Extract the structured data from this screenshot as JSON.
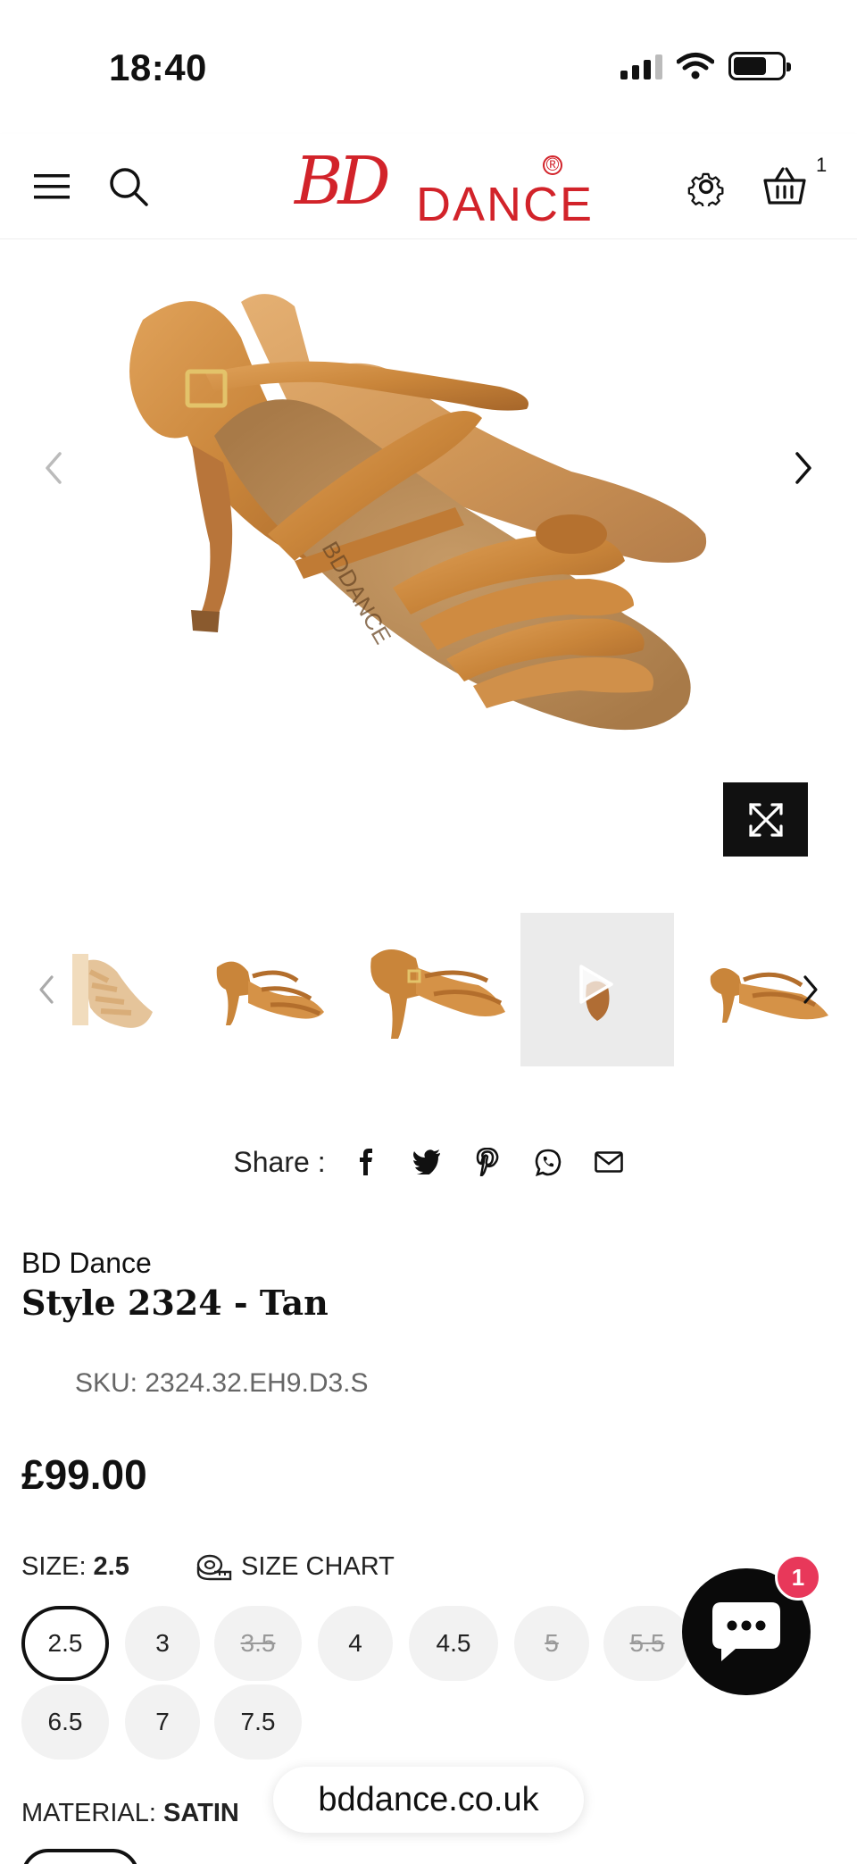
{
  "status_bar": {
    "time": "18:40"
  },
  "header": {
    "logo_script": "BD",
    "logo_text": "DANCE",
    "logo_reg": "®",
    "cart_count": "1"
  },
  "gallery": {
    "thumbnails": [
      "thumb-1",
      "thumb-2",
      "thumb-3",
      "thumb-video",
      "thumb-5"
    ]
  },
  "share": {
    "label": "Share :"
  },
  "product": {
    "brand": "BD Dance",
    "title": "Style 2324 - Tan",
    "sku": "SKU: 2324.32.EH9.D3.S",
    "price": "£99.00",
    "size_label": "SIZE:",
    "size_value": "2.5",
    "size_chart_label": "SIZE CHART",
    "sizes": [
      {
        "label": "2.5",
        "state": "selected"
      },
      {
        "label": "3",
        "state": "available"
      },
      {
        "label": "3.5",
        "state": "unavailable"
      },
      {
        "label": "4",
        "state": "available"
      },
      {
        "label": "4.5",
        "state": "available"
      },
      {
        "label": "5",
        "state": "unavailable"
      },
      {
        "label": "5.5",
        "state": "unavailable"
      },
      {
        "label": "6.5",
        "state": "available"
      },
      {
        "label": "7",
        "state": "available"
      },
      {
        "label": "7.5",
        "state": "available"
      }
    ],
    "material_label": "MATERIAL:",
    "material_value": "SATIN"
  },
  "browser": {
    "url": "bddance.co.uk"
  },
  "chat": {
    "badge": "1"
  },
  "colors": {
    "brand_red": "#d2232a",
    "badge_pink": "#e8385a",
    "satin_tan": "#c9853a"
  }
}
